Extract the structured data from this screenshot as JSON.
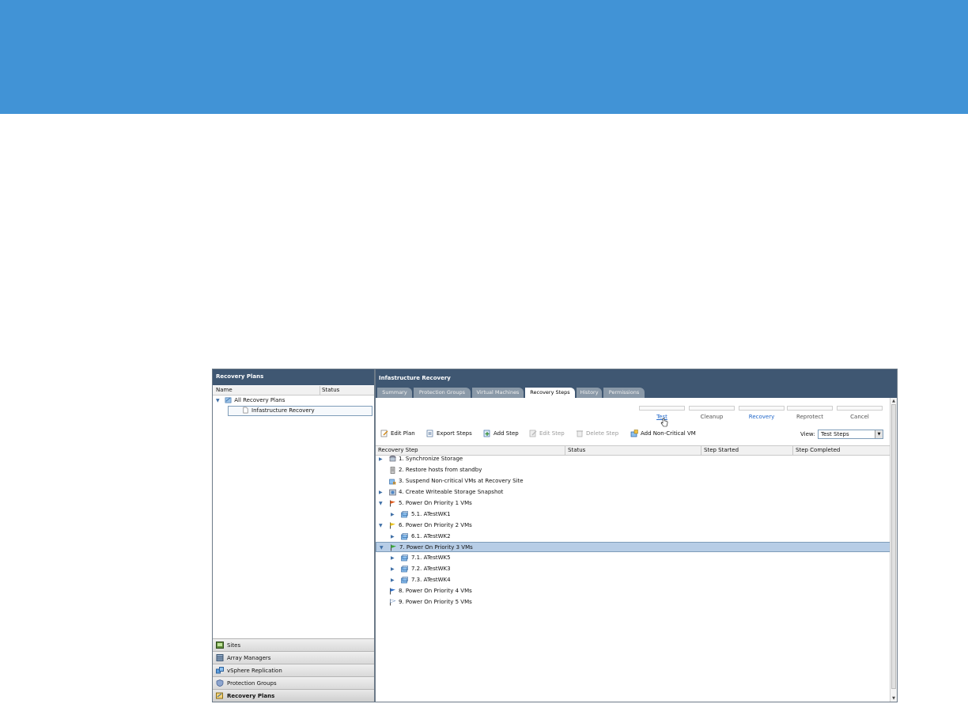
{
  "left_pane": {
    "title": "Recovery Plans",
    "columns": [
      "Name",
      "Status"
    ],
    "tree": [
      {
        "label": "All Recovery Plans",
        "expanded": true
      },
      {
        "label": "Infastructure Recovery",
        "selected": true
      }
    ],
    "nav": [
      {
        "label": "Sites",
        "icon": "sites-icon"
      },
      {
        "label": "Array Managers",
        "icon": "array-managers-icon"
      },
      {
        "label": "vSphere Replication",
        "icon": "vsphere-replication-icon"
      },
      {
        "label": "Protection Groups",
        "icon": "protection-groups-icon"
      },
      {
        "label": "Recovery Plans",
        "icon": "recovery-plans-icon",
        "active": true
      }
    ]
  },
  "right_pane": {
    "title": "Infastructure Recovery",
    "tabs": [
      "Summary",
      "Protection Groups",
      "Virtual Machines",
      "Recovery Steps",
      "History",
      "Permissions"
    ],
    "active_tab": "Recovery Steps",
    "workflow_buttons": [
      "Test",
      "Cleanup",
      "Recovery",
      "Reprotect",
      "Cancel"
    ],
    "toolbar": {
      "edit_plan": "Edit Plan",
      "export_steps": "Export Steps",
      "add_step": "Add Step",
      "edit_step": "Edit Step",
      "delete_step": "Delete Step",
      "add_noncritical_vm": "Add Non-Critical VM",
      "view_label": "View:",
      "view_value": "Test Steps"
    },
    "grid_columns": [
      "Recovery Step",
      "Status",
      "Step Started",
      "Step Completed"
    ],
    "steps": [
      {
        "label": "1. Synchronize Storage",
        "icon": "storage-sync-icon",
        "expander": "collapsed"
      },
      {
        "label": "2. Restore hosts from standby",
        "icon": "host-icon"
      },
      {
        "label": "3. Suspend Non-critical VMs at Recovery Site",
        "icon": "suspend-vm-icon"
      },
      {
        "label": "4. Create Writeable Storage Snapshot",
        "icon": "snapshot-icon",
        "expander": "collapsed"
      },
      {
        "label": "5. Power On Priority 1 VMs",
        "icon": "red-flag-icon",
        "expander": "expanded"
      },
      {
        "label": "5.1. ATestWK1",
        "icon": "vm-icon",
        "expander": "collapsed"
      },
      {
        "label": "6. Power On Priority 2 VMs",
        "icon": "yellow-flag-icon",
        "expander": "expanded"
      },
      {
        "label": "6.1. ATestWK2",
        "icon": "vm-icon",
        "expander": "collapsed"
      },
      {
        "label": "7. Power On Priority 3 VMs",
        "icon": "green-flag-icon",
        "expander": "expanded",
        "selected": true
      },
      {
        "label": "7.1. ATestWK5",
        "icon": "vm-icon",
        "expander": "collapsed"
      },
      {
        "label": "7.2. ATestWK3",
        "icon": "vm-icon",
        "expander": "collapsed"
      },
      {
        "label": "7.3. ATestWK4",
        "icon": "vm-icon",
        "expander": "collapsed"
      },
      {
        "label": "8. Power On Priority 4 VMs",
        "icon": "blue-flag-icon"
      },
      {
        "label": "9. Power On Priority 5 VMs",
        "icon": "white-flag-icon"
      }
    ]
  },
  "colors": {
    "banner": "#4193d6",
    "header": "#3f5772",
    "selection": "#b7cde6",
    "link": "#1f66c9"
  }
}
